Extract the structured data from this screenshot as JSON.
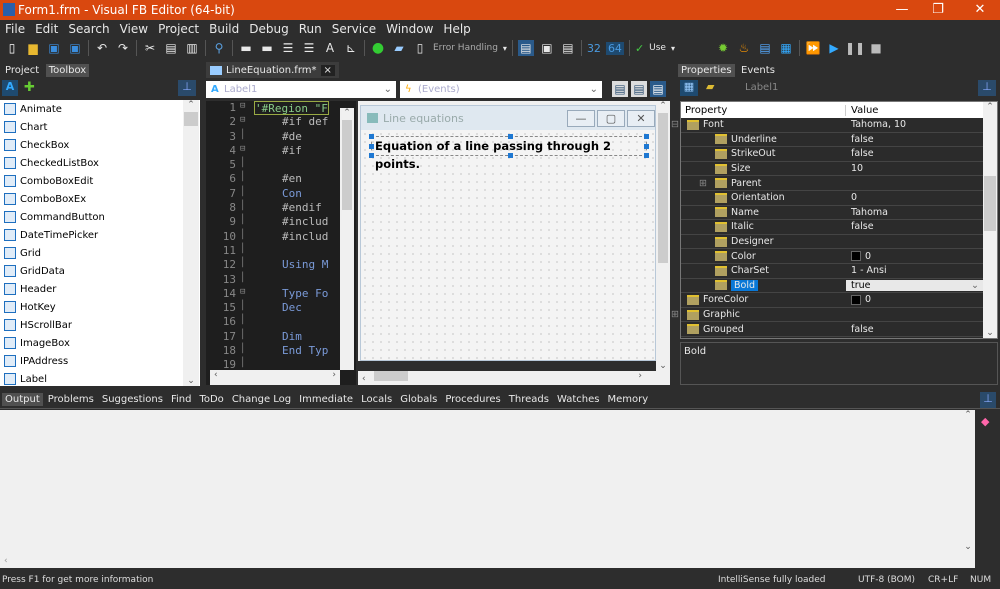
{
  "window": {
    "title": "Form1.frm - Visual FB Editor (64-bit)",
    "minimize": "—",
    "maximize": "❐",
    "close": "✕"
  },
  "menu": [
    "File",
    "Edit",
    "Search",
    "View",
    "Project",
    "Build",
    "Debug",
    "Run",
    "Service",
    "Window",
    "Help"
  ],
  "toolbar": {
    "error_handling": "Error Handling",
    "bit32": "32",
    "bit64": "64",
    "use": "Use"
  },
  "left_tabs": [
    "Project",
    "Toolbox"
  ],
  "toolbox": [
    "Animate",
    "Chart",
    "CheckBox",
    "CheckedListBox",
    "ComboBoxEdit",
    "ComboBoxEx",
    "CommandButton",
    "DateTimePicker",
    "Grid",
    "GridData",
    "Header",
    "HotKey",
    "HScrollBar",
    "ImageBox",
    "IPAddress",
    "Label"
  ],
  "editor": {
    "tab": "LineEquation.frm*",
    "control_combo": "Label1",
    "events_combo": "(Events)",
    "lines": [
      [
        "1",
        "'#Region \"F"
      ],
      [
        "2",
        "#if def"
      ],
      [
        "3",
        "    #de"
      ],
      [
        "4",
        "    #if"
      ],
      [
        "5",
        ""
      ],
      [
        "6",
        "    #en"
      ],
      [
        "7",
        "    Con"
      ],
      [
        "8",
        "#endif"
      ],
      [
        "9",
        "#includ"
      ],
      [
        "10",
        "#includ"
      ],
      [
        "11",
        ""
      ],
      [
        "12",
        "Using M"
      ],
      [
        "13",
        ""
      ],
      [
        "14",
        "Type Fo"
      ],
      [
        "15",
        "    Dec"
      ],
      [
        "16",
        ""
      ],
      [
        "17",
        "    Dim"
      ],
      [
        "18",
        "End Typ"
      ],
      [
        "19",
        ""
      ]
    ]
  },
  "form": {
    "title": "Line equations",
    "label_text": "Equation of a line passing through 2 points."
  },
  "properties": {
    "tabs": [
      "Properties",
      "Events"
    ],
    "object": "Label1",
    "header": [
      "Property",
      "Value"
    ],
    "rows": [
      {
        "name": "Font",
        "value": "Tahoma, 10",
        "level": 0,
        "expander": "⊟"
      },
      {
        "name": "Underline",
        "value": "false",
        "level": 1
      },
      {
        "name": "StrikeOut",
        "value": "false",
        "level": 1
      },
      {
        "name": "Size",
        "value": "10",
        "level": 1
      },
      {
        "name": "Parent",
        "value": "",
        "level": 1,
        "expander": "⊞"
      },
      {
        "name": "Orientation",
        "value": "0",
        "level": 1
      },
      {
        "name": "Name",
        "value": "Tahoma",
        "level": 1
      },
      {
        "name": "Italic",
        "value": "false",
        "level": 1
      },
      {
        "name": "Designer",
        "value": "",
        "level": 1
      },
      {
        "name": "Color",
        "value": "0",
        "level": 1,
        "swatch": "#000000"
      },
      {
        "name": "CharSet",
        "value": "1 - Ansi",
        "level": 1
      },
      {
        "name": "Bold",
        "value": "true",
        "level": 1,
        "selected": true
      },
      {
        "name": "ForeColor",
        "value": "0",
        "level": 0,
        "swatch": "#000000"
      },
      {
        "name": "Graphic",
        "value": "",
        "level": 0,
        "expander": "⊞"
      },
      {
        "name": "Grouped",
        "value": "false",
        "level": 0
      }
    ],
    "description": "Bold"
  },
  "bottom_tabs": [
    "Output",
    "Problems",
    "Suggestions",
    "Find",
    "ToDo",
    "Change Log",
    "Immediate",
    "Locals",
    "Globals",
    "Procedures",
    "Threads",
    "Watches",
    "Memory"
  ],
  "status": {
    "help": "Press F1 for get more information",
    "intellisense": "IntelliSense fully loaded",
    "encoding": "UTF-8 (BOM)",
    "eol": "CR+LF",
    "num": "NUM"
  },
  "colors": {
    "title_bar": "#d9480f",
    "selection": "#0a78d7"
  }
}
